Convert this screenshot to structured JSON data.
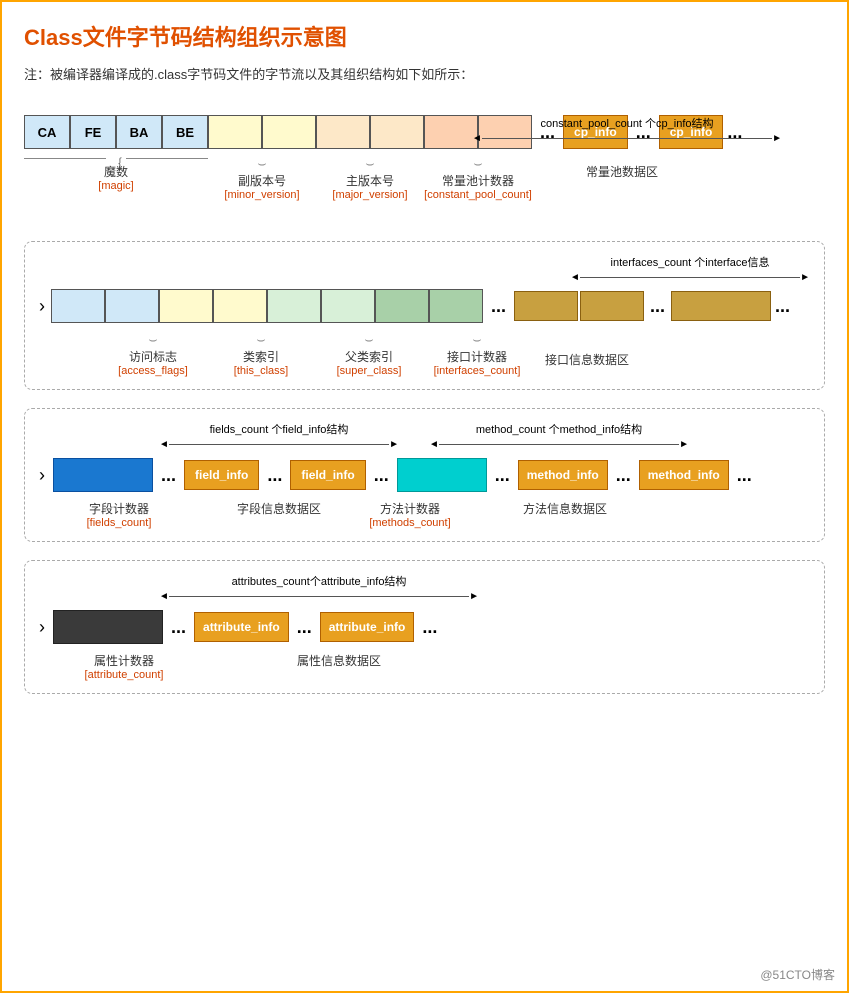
{
  "title": "Class文件字节码结构组织示意图",
  "note": "注：被编译器编译成的.class字节码文件的字节流以及其组织结构如下如所示：",
  "watermark": "@51CTO博客",
  "section1": {
    "constant_pool_arrow_label": "constant_pool_count 个cp_info结构",
    "bytes": [
      "CA",
      "FE",
      "BA",
      "BE"
    ],
    "magic_cn": "魔数",
    "magic_en": "[magic]",
    "minor_cn": "副版本号",
    "minor_en": "[minor_version]",
    "major_cn": "主版本号",
    "major_en": "[major_version]",
    "const_count_cn": "常量池计数器",
    "const_count_en": "[constant_pool_count]",
    "const_data_cn": "常量池数据区",
    "cp_info": "cp_info"
  },
  "section2": {
    "interfaces_arrow_label": "interfaces_count 个interface信息",
    "access_cn": "访问标志",
    "access_en": "[access_flags]",
    "this_cn": "类索引",
    "this_en": "[this_class]",
    "super_cn": "父类索引",
    "super_en": "[super_class]",
    "iface_count_cn": "接口计数器",
    "iface_count_en": "[interfaces_count]",
    "iface_data_cn": "接口信息数据区"
  },
  "section3": {
    "fields_arrow_label": "fields_count 个field_info结构",
    "methods_arrow_label": "method_count 个method_info结构",
    "field_count_cn": "字段计数器",
    "field_count_en": "[fields_count]",
    "field_data_cn": "字段信息数据区",
    "method_count_cn": "方法计数器",
    "method_count_en": "[methods_count]",
    "method_data_cn": "方法信息数据区",
    "field_info": "field_info",
    "method_info": "method_info"
  },
  "section4": {
    "attributes_arrow_label": "attributes_count个attribute_info结构",
    "attr_count_cn": "属性计数器",
    "attr_count_en": "[attribute_count]",
    "attr_data_cn": "属性信息数据区",
    "attribute_info": "attribute_info"
  }
}
